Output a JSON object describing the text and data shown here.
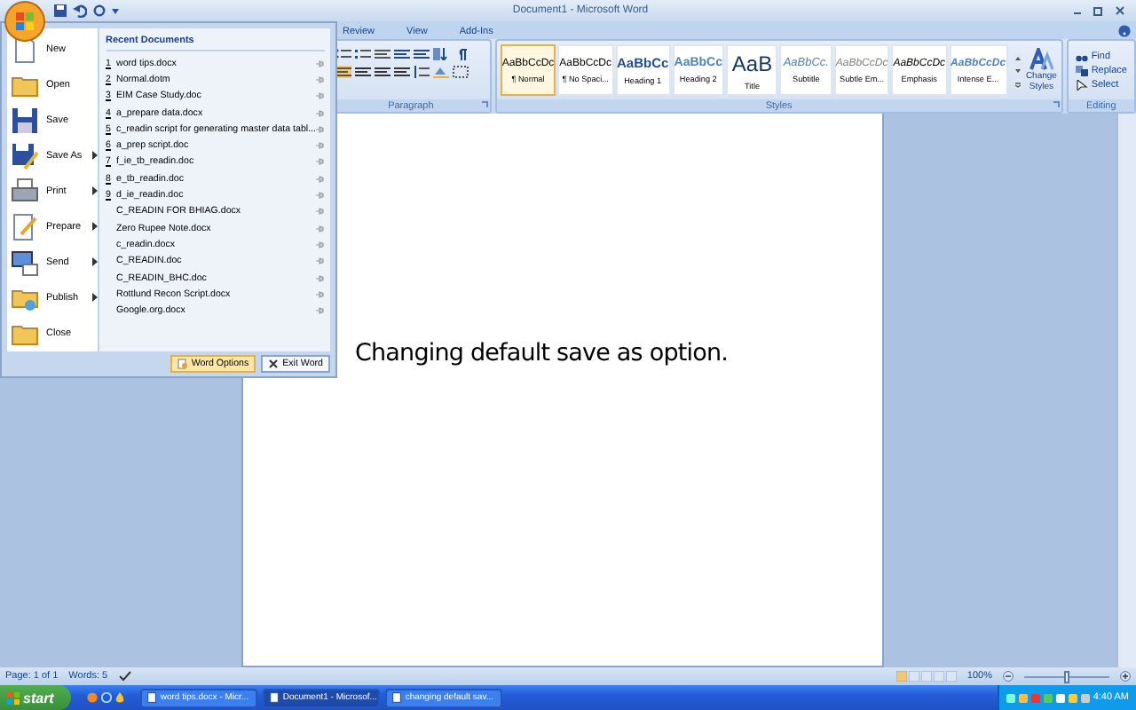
{
  "window": {
    "title": "Document1 - Microsoft Word"
  },
  "ribbon_tabs": [
    {
      "label": "Review",
      "selected": false
    },
    {
      "label": "View",
      "selected": false
    },
    {
      "label": "Add-Ins",
      "selected": false
    }
  ],
  "paragraph_group": {
    "label": "Paragraph"
  },
  "styles_group": {
    "label": "Styles",
    "change_styles": "Change Styles",
    "styles": [
      {
        "preview": "AaBbCcDc",
        "label": "¶ Normal",
        "kind": "normal",
        "selected": true
      },
      {
        "preview": "AaBbCcDc",
        "label": "¶ No Spaci...",
        "kind": "normal",
        "selected": false
      },
      {
        "preview": "AaBbCc",
        "label": "Heading 1",
        "kind": "heading1",
        "selected": false
      },
      {
        "preview": "AaBbCc",
        "label": "Heading 2",
        "kind": "heading2",
        "selected": false
      },
      {
        "preview": "AaB",
        "label": "Title",
        "kind": "title",
        "selected": false
      },
      {
        "preview": "AaBbCc.",
        "label": "Subtitle",
        "kind": "subtitle",
        "selected": false
      },
      {
        "preview": "AaBbCcDc",
        "label": "Subtle Em...",
        "kind": "subtle",
        "selected": false
      },
      {
        "preview": "AaBbCcDc",
        "label": "Emphasis",
        "kind": "emphasis",
        "selected": false
      },
      {
        "preview": "AaBbCcDc",
        "label": "Intense E...",
        "kind": "intense",
        "selected": false
      }
    ]
  },
  "editing_group": {
    "label": "Editing",
    "commands": [
      "Find",
      "Replace",
      "Select"
    ]
  },
  "office_menu": {
    "commands": [
      {
        "label": "New",
        "has_submenu": false
      },
      {
        "label": "Open",
        "has_submenu": false
      },
      {
        "label": "Save",
        "has_submenu": false
      },
      {
        "label": "Save As",
        "has_submenu": true
      },
      {
        "label": "Print",
        "has_submenu": true
      },
      {
        "label": "Prepare",
        "has_submenu": true
      },
      {
        "label": "Send",
        "has_submenu": true
      },
      {
        "label": "Publish",
        "has_submenu": true
      },
      {
        "label": "Close",
        "has_submenu": false
      }
    ],
    "recent_title": "Recent Documents",
    "recent": [
      {
        "number": "1",
        "name": "word tips.docx"
      },
      {
        "number": "2",
        "name": "Normal.dotm"
      },
      {
        "number": "3",
        "name": "EIM Case Study.doc"
      },
      {
        "number": "4",
        "name": "a_prepare data.docx"
      },
      {
        "number": "5",
        "name": "c_readin script for generating master data tabl..."
      },
      {
        "number": "6",
        "name": "a_prep script.doc"
      },
      {
        "number": "7",
        "name": "f_ie_tb_readin.doc"
      },
      {
        "number": "8",
        "name": "e_tb_readin.doc"
      },
      {
        "number": "9",
        "name": "d_ie_readin.doc"
      },
      {
        "name": "C_READIN FOR BHIAG.docx"
      },
      {
        "name": "Zero Rupee Note.docx"
      },
      {
        "name": "c_readin.docx"
      },
      {
        "name": "C_READIN.doc"
      },
      {
        "name": "C_READIN_BHC.doc"
      },
      {
        "name": "Rottlund Recon Script.docx"
      },
      {
        "name": "Google.org.docx"
      }
    ],
    "buttons": [
      "Word Options",
      "Exit Word"
    ]
  },
  "document": {
    "text": "Changing default save as option."
  },
  "status_bar": {
    "page": "Page: 1 of 1",
    "words": "Words: 5",
    "zoom": "100%",
    "zoom_level": {
      "level": 0.5
    }
  },
  "taskbar": {
    "start": "start",
    "tasks": [
      {
        "label": "word tips.docx - Micr...",
        "selected": false
      },
      {
        "label": "Document1 - Microsof...",
        "selected": true
      },
      {
        "label": "changing default sav...",
        "selected": false
      }
    ],
    "clock": "4:40 AM"
  }
}
